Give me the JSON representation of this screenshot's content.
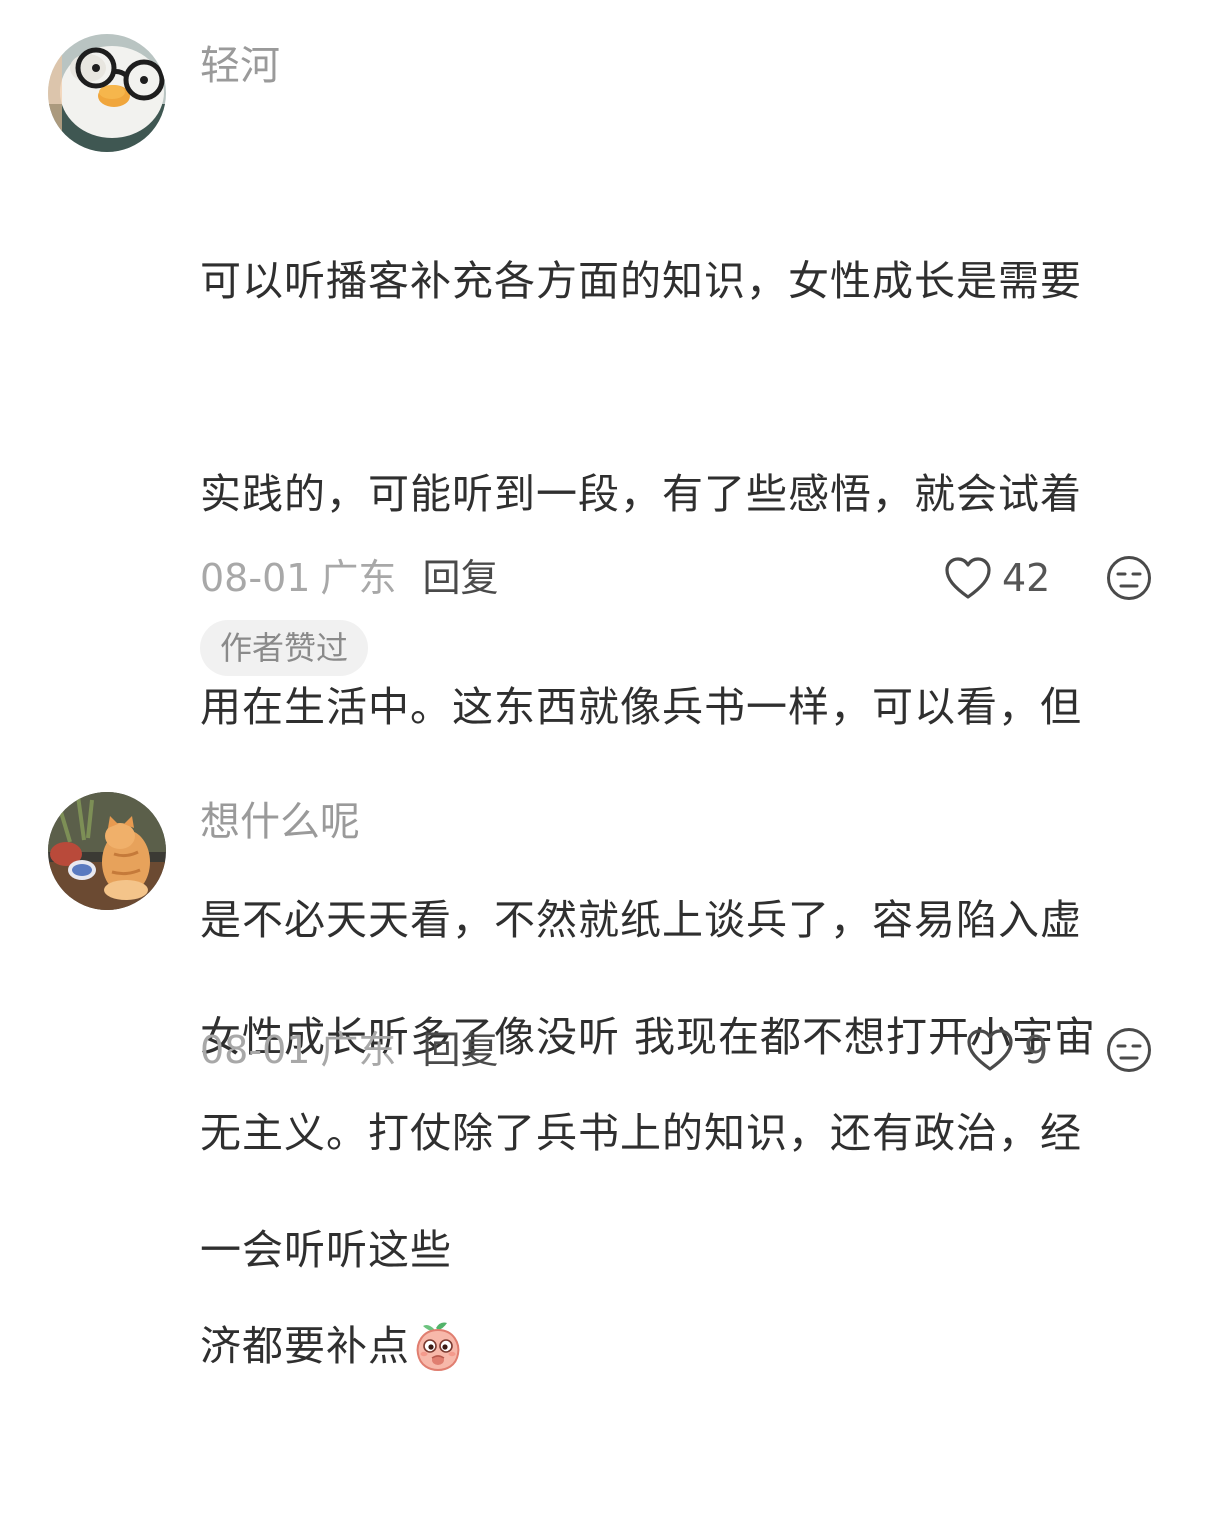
{
  "comments": [
    {
      "username": "轻河",
      "avatar": "duck-with-glasses-avatar",
      "lines": [
        "可以听播客补充各方面的知识，女性成长是需要",
        "实践的，可能听到一段，有了些感悟，就会试着",
        "用在生活中。这东西就像兵书一样，可以看，但",
        "是不必天天看，不然就纸上谈兵了，容易陷入虚",
        "无主义。打仗除了兵书上的知识，还有政治，经",
        "济都要补点"
      ],
      "emoji": "peach-emoji",
      "date": "08-01",
      "location": "广东",
      "reply_label": "回复",
      "like_count": "42",
      "like_icon": "heart-outline-icon",
      "dislike_icon": "unamused-face-icon",
      "badge": "作者赞过"
    },
    {
      "username": "想什么呢",
      "avatar": "orange-cat-avatar",
      "lines": [
        "女性成长听多了像没听 我现在都不想打开小宇宙",
        "一会听听这些"
      ],
      "date": "08-01",
      "location": "广东",
      "reply_label": "回复",
      "like_count": "9",
      "like_icon": "heart-outline-icon",
      "dislike_icon": "unamused-face-icon"
    }
  ],
  "colors": {
    "username": "#9a9a9a",
    "content": "#2f2f2f",
    "meta": "#a8a8a8",
    "reply": "#4a4a4a",
    "badge_bg": "#f1f1f1",
    "badge_text": "#8a8a8a"
  }
}
